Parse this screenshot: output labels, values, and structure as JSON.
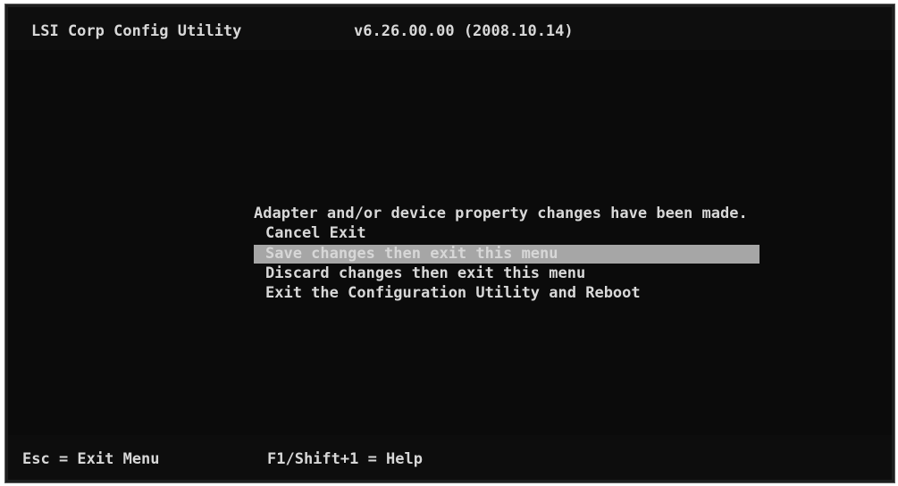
{
  "header": {
    "title": "LSI Corp Config Utility",
    "version": "v6.26.00.00 (2008.10.14)"
  },
  "dialog": {
    "message": "Adapter and/or device property changes have been made.",
    "options": [
      {
        "label": "Cancel Exit",
        "selected": false
      },
      {
        "label": "Save changes then exit this menu",
        "selected": true
      },
      {
        "label": "Discard changes then exit this menu",
        "selected": false
      },
      {
        "label": "Exit the Configuration Utility and Reboot",
        "selected": false
      }
    ]
  },
  "footer": {
    "exit_hint": "Esc = Exit Menu",
    "help_hint": "F1/Shift+1 = Help"
  },
  "colors": {
    "background": "#0b0b0b",
    "text": "#d8d8d8",
    "highlight_bar": "#a6a6a6"
  }
}
